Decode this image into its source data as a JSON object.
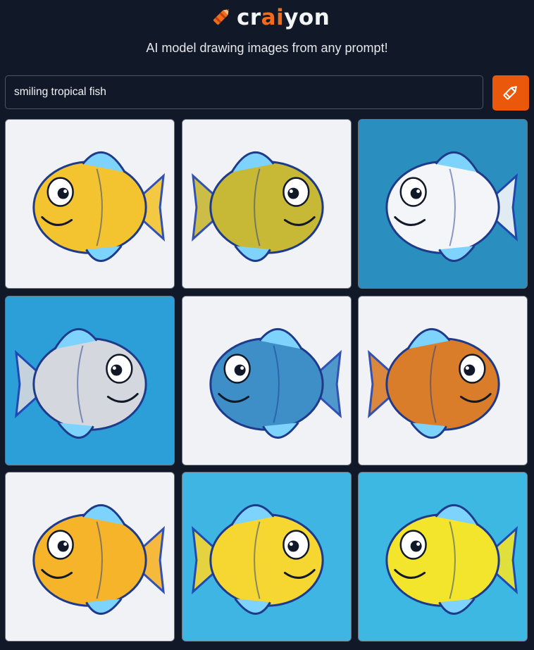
{
  "brand": {
    "name_prefix": "cr",
    "name_accent": "ai",
    "name_suffix": "yon",
    "accent_color": "#f26b1d",
    "logo_icon": "crayon-pencil-icon"
  },
  "tagline": "AI model drawing images from any prompt!",
  "search": {
    "value": "smiling tropical fish",
    "button_icon": "pencil-icon",
    "button_color": "#ea580c"
  },
  "results": {
    "images": [
      {
        "name": "generated-image-1",
        "bg": "#f1f2f6",
        "fish": "#f4c430"
      },
      {
        "name": "generated-image-2",
        "bg": "#f1f2f6",
        "fish": "#c7b835"
      },
      {
        "name": "generated-image-3",
        "bg": "#2a8fbf",
        "fish": "#f4f5f8"
      },
      {
        "name": "generated-image-4",
        "bg": "#2d9fd8",
        "fish": "#d4d8de"
      },
      {
        "name": "generated-image-5",
        "bg": "#f1f2f6",
        "fish": "#3e8fc8"
      },
      {
        "name": "generated-image-6",
        "bg": "#f1f2f6",
        "fish": "#d97d2a"
      },
      {
        "name": "generated-image-7",
        "bg": "#f1f2f6",
        "fish": "#f6b42a"
      },
      {
        "name": "generated-image-8",
        "bg": "#3fb5e4",
        "fish": "#f6d630"
      },
      {
        "name": "generated-image-9",
        "bg": "#3cb8e2",
        "fish": "#f2e52c"
      }
    ]
  }
}
